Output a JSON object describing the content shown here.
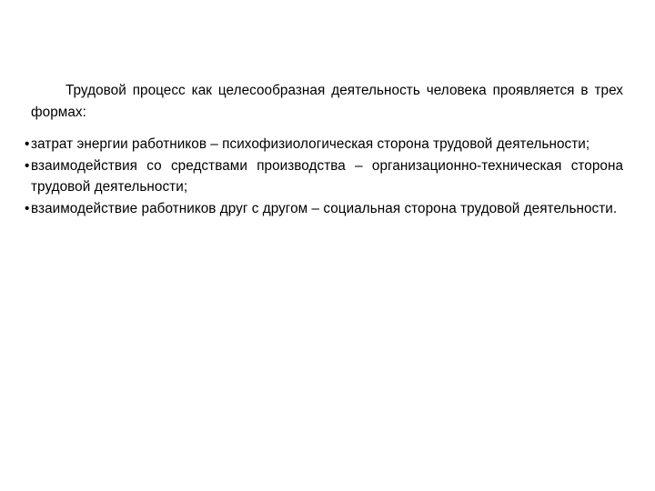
{
  "slide": {
    "background_color": "#ffffff",
    "text_color": "#000000",
    "intro_paragraph": "Трудовой процесс как целесообразная деятельность человека проявляется в трех формах:",
    "bullet_marker": "•",
    "bullets": [
      {
        "text": "затрат энергии работников – психофизиологическая сторона трудовой деятельности;"
      },
      {
        "text": "взаимодействия со средствами производства – организационно-техническая сторона трудовой деятельности;"
      },
      {
        "text": "взаимодействие работников друг с другом – социальная сторона трудовой деятельности."
      }
    ]
  }
}
